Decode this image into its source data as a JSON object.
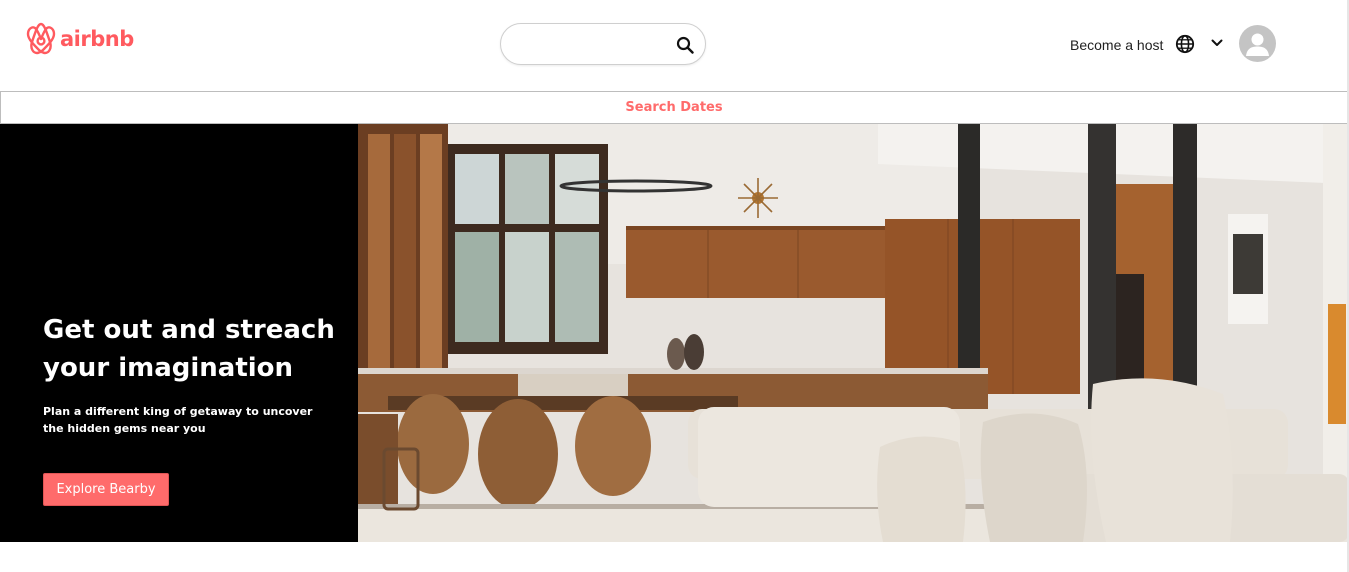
{
  "header": {
    "logo_text": "airbnb",
    "search_placeholder": "",
    "host_link": "Become a host",
    "icons": {
      "logo": "airbnb-logo-icon",
      "search": "search-icon",
      "globe": "globe-icon",
      "chevron": "chevron-down-icon",
      "avatar": "user-avatar-icon"
    }
  },
  "dates_bar": {
    "label": "Search Dates"
  },
  "hero": {
    "title": "Get out and streach your imagination",
    "subtitle": "Plan a different king of getaway to uncover the hidden gems near you",
    "button_label": "Explore Bearby",
    "image": "interior-kitchen-living-room-photo"
  },
  "colors": {
    "brand": "#ff5a5f",
    "accent": "#ff6b6b",
    "hero_bg": "#000000"
  }
}
